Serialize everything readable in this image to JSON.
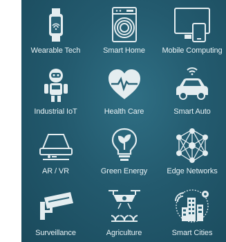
{
  "colors": {
    "panel_background": "#235a6e",
    "icon_color": "#e4edf0",
    "label_color": "#eaf3f6"
  },
  "tiles": [
    {
      "label": "Wearable Tech",
      "icon": "smartwatch-icon"
    },
    {
      "label": "Smart Home",
      "icon": "washing-machine-icon"
    },
    {
      "label": "Mobile Computing",
      "icon": "devices-icon"
    },
    {
      "label": "Industrial  IoT",
      "icon": "robot-icon"
    },
    {
      "label": "Health Care",
      "icon": "heart-pulse-icon"
    },
    {
      "label": "Smart Auto",
      "icon": "connected-car-icon"
    },
    {
      "label": "AR / VR",
      "icon": "vr-glasses-icon"
    },
    {
      "label": "Green Energy",
      "icon": "lightbulb-plant-icon"
    },
    {
      "label": "Edge Networks",
      "icon": "network-mesh-icon"
    },
    {
      "label": "Surveillance",
      "icon": "security-camera-icon"
    },
    {
      "label": "Agriculture",
      "icon": "drone-crops-icon"
    },
    {
      "label": "Smart Cities",
      "icon": "city-buildings-icon"
    }
  ]
}
